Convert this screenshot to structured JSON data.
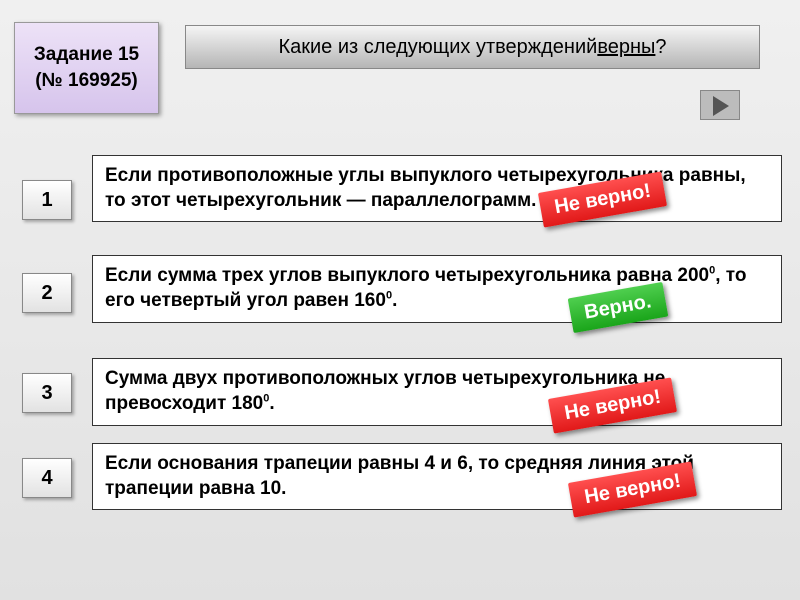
{
  "task": {
    "label_line1": "Задание 15",
    "label_line2": "(№ 169925)"
  },
  "question": {
    "prefix": "Какие из следующих утверждений ",
    "keyword": "верны",
    "suffix": "?"
  },
  "stamps": {
    "incorrect": "Не верно!",
    "correct": "Верно."
  },
  "options": [
    {
      "num": "1",
      "text": "Если противоположные углы выпуклого четырехугольника равны, то этот четырехугольник — параллелограмм.",
      "verdict": "incorrect"
    },
    {
      "num": "2",
      "text_html": "Если сумма трех углов выпуклого четырехугольника равна 200<sup>0</sup>, то его четвертый угол равен 160<sup>0</sup>.",
      "verdict": "correct"
    },
    {
      "num": "3",
      "text_html": "Сумма двух противоположных углов четырехугольника не превосходит 180<sup>0</sup>.",
      "verdict": "incorrect"
    },
    {
      "num": "4",
      "text": "Если основания трапеции равны 4 и 6, то средняя линия этой трапеции равна 10.",
      "verdict": "incorrect"
    }
  ]
}
